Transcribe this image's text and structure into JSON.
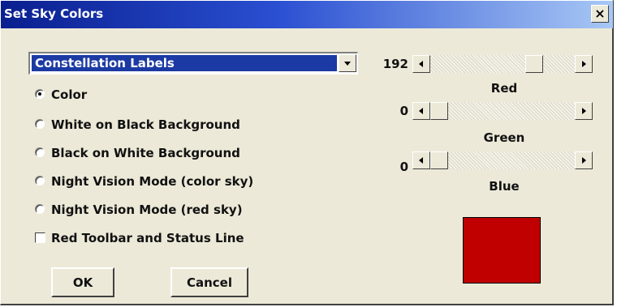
{
  "window": {
    "title": "Set Sky Colors",
    "close_label": "×"
  },
  "dropdown": {
    "selected": "Constellation Labels"
  },
  "options": [
    {
      "label": "Color",
      "selected": true
    },
    {
      "label": "White on Black Background",
      "selected": false
    },
    {
      "label": "Black on White Background",
      "selected": false
    },
    {
      "label": "Night Vision Mode (color sky)",
      "selected": false
    },
    {
      "label": "Night Vision Mode (red sky)",
      "selected": false
    }
  ],
  "checkbox": {
    "label": "Red Toolbar and Status Line",
    "checked": false
  },
  "buttons": {
    "ok": "OK",
    "cancel": "Cancel"
  },
  "sliders": {
    "red": {
      "value": "192",
      "label": "Red",
      "fraction": 0.753
    },
    "green": {
      "value": "0",
      "label": "Green",
      "fraction": 0
    },
    "blue": {
      "value": "0",
      "label": "Blue",
      "fraction": 0
    }
  },
  "preview": {
    "color": "#c00000"
  },
  "icons": {
    "radio": "radio-button",
    "close": "close-icon",
    "dropdown": "chevron-down-icon"
  }
}
